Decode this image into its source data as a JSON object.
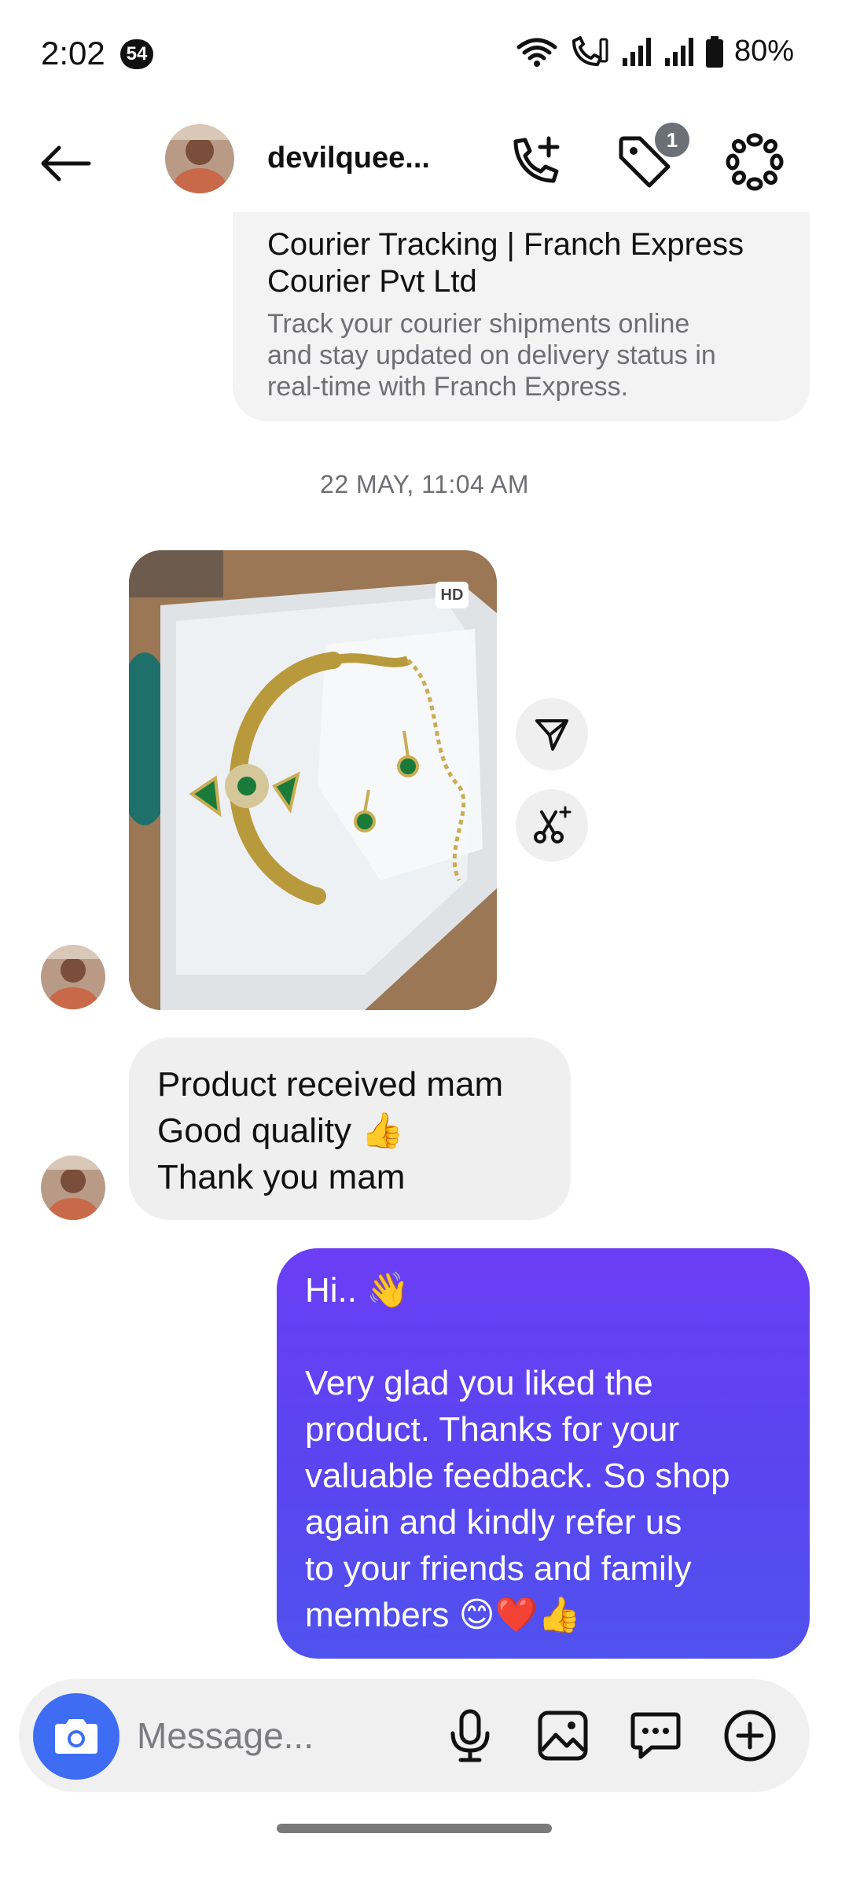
{
  "status_bar": {
    "time": "2:02",
    "notification_count": "54",
    "battery": "80%"
  },
  "header": {
    "username": "devilquee...",
    "tag_badge_count": "1",
    "icons": [
      "back-arrow-icon",
      "add-call-icon",
      "tag-icon",
      "more-options-icon"
    ]
  },
  "link_preview": {
    "title_line1": "Courier Tracking | Franch Express",
    "title_line2": "Courier Pvt Ltd",
    "desc_line1": "Track your courier shipments online",
    "desc_line2": "and stay updated on delivery status in",
    "desc_line3": "real-time with Franch Express."
  },
  "timestamp": "22 MAY, 11:04 AM",
  "photo_message": {
    "hd_label": "HD"
  },
  "received_message": {
    "lines": [
      "Product received mam",
      "Good quality 👍",
      "Thank you mam"
    ]
  },
  "sent_message": {
    "lines": [
      "Hi.. 👋",
      "",
      "Very glad you liked the",
      "product. Thanks for your",
      "valuable feedback. So shop",
      "again and kindly refer us",
      "to your friends and family",
      "members 😊❤️👍"
    ]
  },
  "composer": {
    "placeholder": "Message..."
  },
  "colors": {
    "sent_bubble_top": "#6b3ef5",
    "sent_bubble_bottom": "#5052ee",
    "camera_button": "#3e6df3",
    "received_bubble": "#efefef"
  }
}
